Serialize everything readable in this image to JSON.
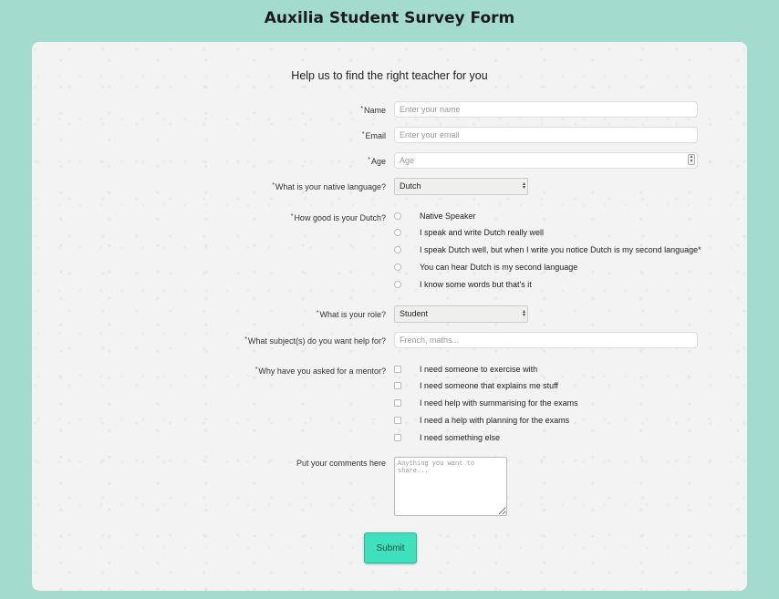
{
  "header": {
    "title": "Auxilia Student Survey Form"
  },
  "form": {
    "subtitle": "Help us to find the right teacher for you",
    "required_mark": "*",
    "name": {
      "label": "Name",
      "placeholder": "Enter your name"
    },
    "email": {
      "label": "Email",
      "placeholder": "Enter your email"
    },
    "age": {
      "label": "Age",
      "placeholder": "Age"
    },
    "native_language": {
      "label": "What is your native language?",
      "selected": "Dutch"
    },
    "proficiency": {
      "label": "How good is your Dutch?",
      "options": [
        "Native Speaker",
        "I speak and write Dutch really well",
        "I speak Dutch well, but when I write you notice Dutch is my second language*",
        "You can hear Dutch is my second language",
        "I know some words but that's it"
      ]
    },
    "role": {
      "label": "What is your role?",
      "selected": "Student"
    },
    "subjects": {
      "label": "What subject(s) do you want help for?",
      "placeholder": "French, maths..."
    },
    "mentor_reason": {
      "label": "Why have you asked for a mentor?",
      "options": [
        "I need someone to exercise with",
        "I need someone that explains me stuff",
        "I need help with summarising for the exams",
        "I need a help with planning for the exams",
        "I need something else"
      ]
    },
    "comments": {
      "label": "Put your comments here",
      "placeholder": "Anything you want to share..."
    },
    "submit_label": "Submit"
  }
}
